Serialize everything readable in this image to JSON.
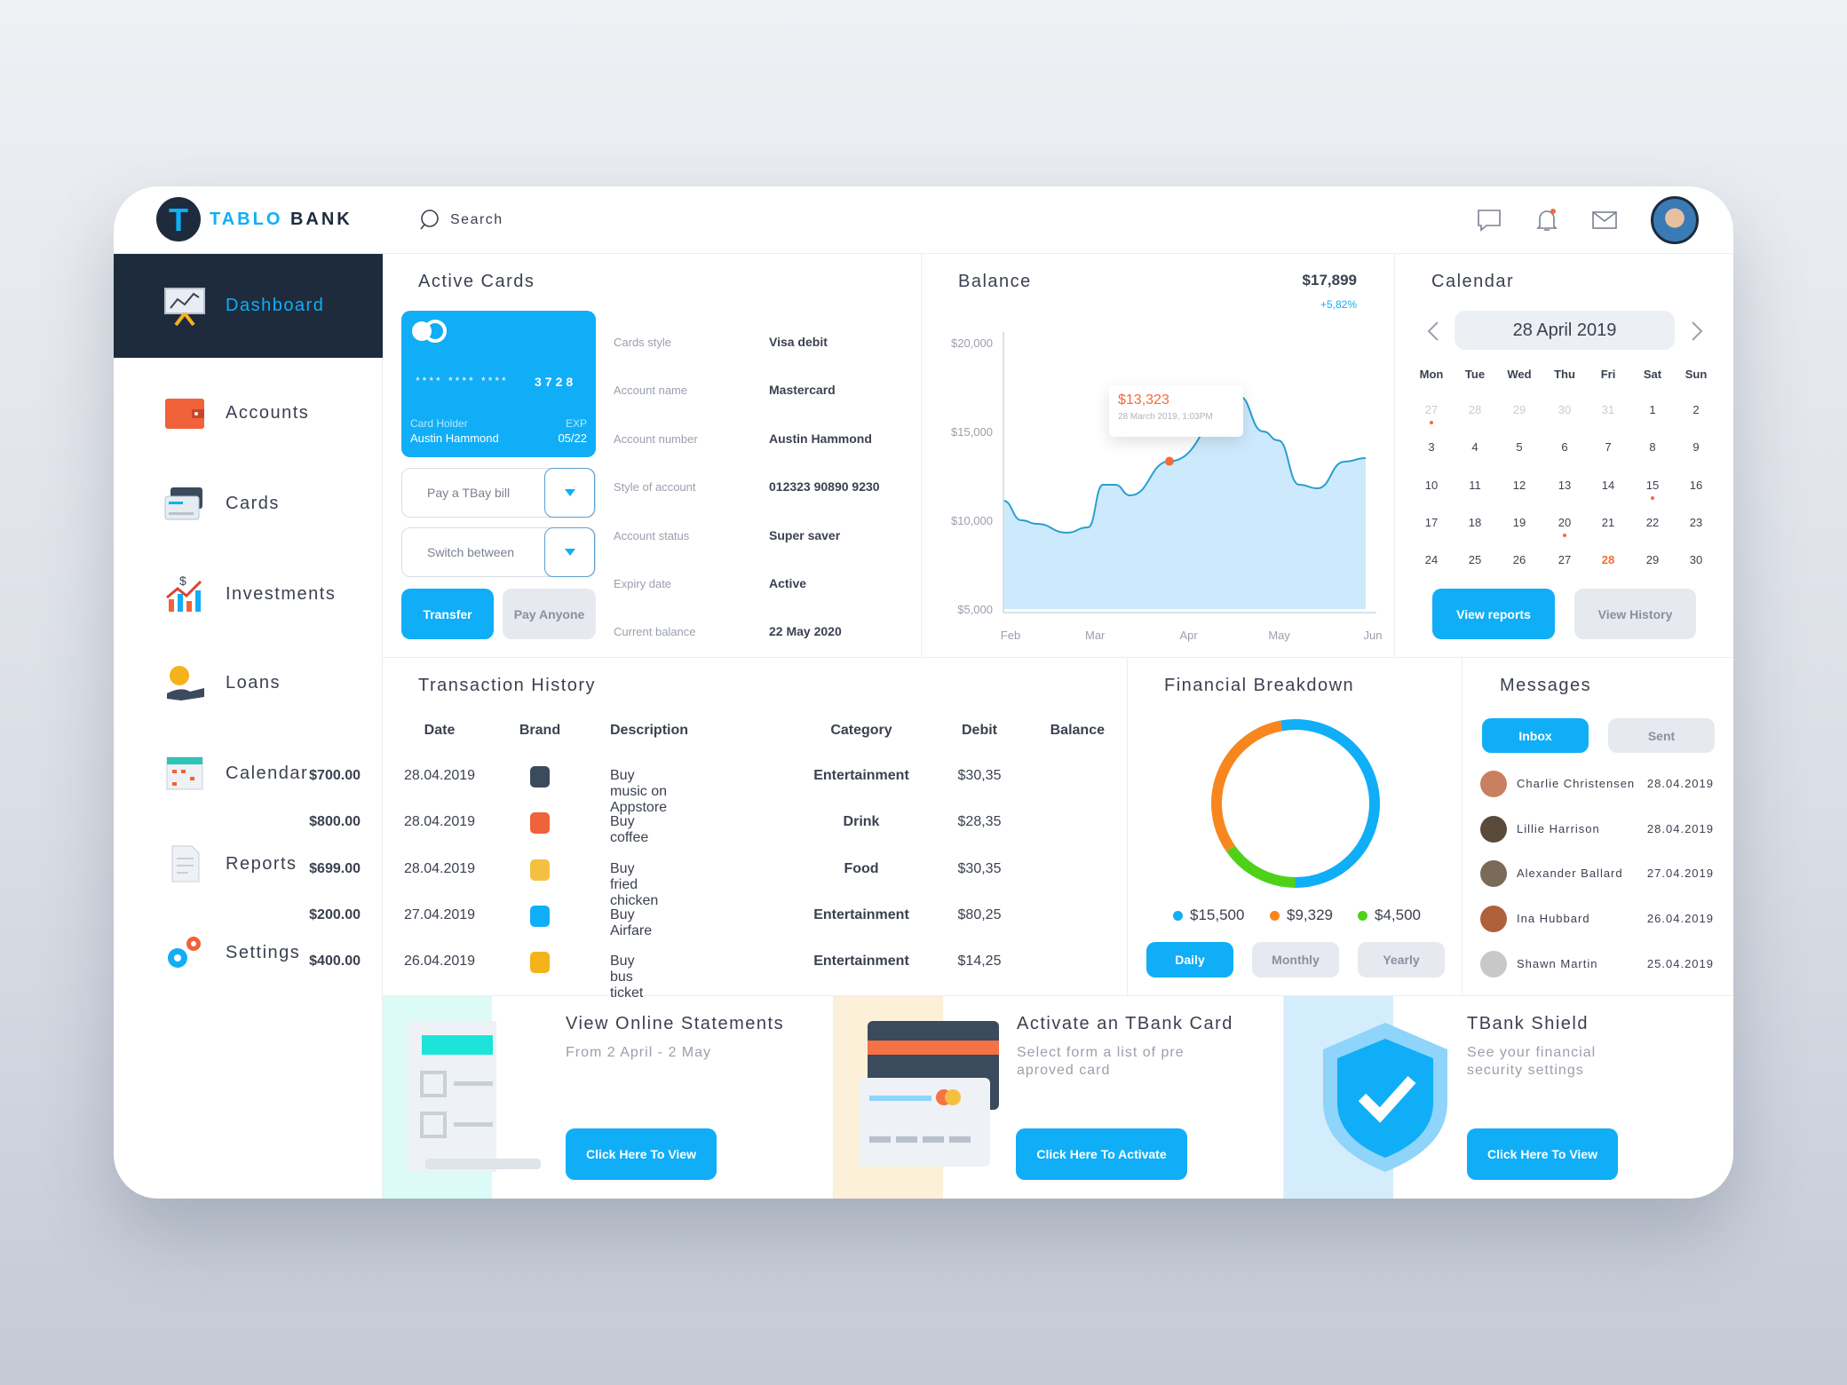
{
  "brand": {
    "name_part1": "TABLO",
    "name_part2": "BANK",
    "logo_letter": "T"
  },
  "header": {
    "search_placeholder": "Search",
    "icons": [
      "chat-icon",
      "bell-icon",
      "mail-icon"
    ]
  },
  "sidebar": {
    "items": [
      {
        "label": "Dashboard",
        "icon": "dashboard-icon",
        "active": true
      },
      {
        "label": "Accounts",
        "icon": "wallet-icon"
      },
      {
        "label": "Cards",
        "icon": "cards-icon"
      },
      {
        "label": "Investments",
        "icon": "investments-icon"
      },
      {
        "label": "Loans",
        "icon": "loans-icon"
      },
      {
        "label": "Calendar",
        "icon": "calendar-icon"
      },
      {
        "label": "Reports",
        "icon": "reports-icon"
      },
      {
        "label": "Settings",
        "icon": "settings-icon"
      }
    ]
  },
  "active_cards": {
    "title": "Active Cards",
    "card": {
      "number_mask": "****  ****  ****",
      "last4": "3728",
      "holder_label": "Card Holder",
      "holder": "Austin Hammond",
      "exp_label": "EXP",
      "exp": "05/22"
    },
    "dropdown1": "Pay a TBay bill",
    "dropdown2": "Switch between",
    "transfer": "Transfer",
    "pay_anyone": "Pay Anyone",
    "details": [
      {
        "label": "Cards style",
        "value": "Visa debit"
      },
      {
        "label": "Account name",
        "value": "Mastercard"
      },
      {
        "label": "Account number",
        "value": "Austin Hammond"
      },
      {
        "label": "Style of account",
        "value": "012323 90890 9230"
      },
      {
        "label": "Account status",
        "value": "Super saver"
      },
      {
        "label": "Expiry date",
        "value": "Active"
      },
      {
        "label": "Current balance",
        "value": "22 May 2020"
      }
    ]
  },
  "balance": {
    "title": "Balance",
    "total": "$17,899",
    "change": "+5,82%"
  },
  "chart_data": [
    {
      "type": "area",
      "title": "Balance",
      "ylim": [
        5000,
        20000
      ],
      "yticks": [
        "$20,000",
        "$15,000",
        "$10,000",
        "$5,000"
      ],
      "ytick_values": [
        20000,
        15000,
        10000,
        5000
      ],
      "xticks": [
        "Feb",
        "Mar",
        "Apr",
        "May",
        "Jun"
      ],
      "xtick_dates": [
        "2019-02-01",
        "2019-03-01",
        "2019-04-01",
        "2019-05-01",
        "2019-06-01"
      ],
      "grid": false,
      "color": "#2a9fd0",
      "fill": "#cdeafc",
      "points": [
        {
          "date": "2019-02-01",
          "value": 11100
        },
        {
          "date": "2019-02-07",
          "value": 10000
        },
        {
          "date": "2019-02-12",
          "value": 9800
        },
        {
          "date": "2019-02-22",
          "value": 9300
        },
        {
          "date": "2019-03-01",
          "value": 9600
        },
        {
          "date": "2019-03-06",
          "value": 12000
        },
        {
          "date": "2019-03-10",
          "value": 12000
        },
        {
          "date": "2019-03-15",
          "value": 11400
        },
        {
          "date": "2019-03-28",
          "value": 13323
        },
        {
          "date": "2019-04-20",
          "value": 17000
        },
        {
          "date": "2019-04-28",
          "value": 15000
        },
        {
          "date": "2019-05-03",
          "value": 14500
        },
        {
          "date": "2019-05-10",
          "value": 12000
        },
        {
          "date": "2019-05-16",
          "value": 11800
        },
        {
          "date": "2019-05-25",
          "value": 13300
        },
        {
          "date": "2019-06-01",
          "value": 13500
        }
      ],
      "tooltip": {
        "date": "2019-03-28",
        "value_label": "$13,323",
        "date_label": "28 March 2019, 1:03PM",
        "color": "#f26b3a"
      }
    },
    {
      "type": "pie",
      "title": "Financial Breakdown",
      "donut": true,
      "slices": [
        {
          "label": "$15,500",
          "value": 15500,
          "color": "#10aef7"
        },
        {
          "label": "$9,329",
          "value": 9329,
          "color": "#f7861e"
        },
        {
          "label": "$4,500",
          "value": 4500,
          "color": "#4fd11a"
        }
      ]
    }
  ],
  "calendar": {
    "title": "Calendar",
    "date": "28 April 2019",
    "weekdays": [
      "Mon",
      "Tue",
      "Wed",
      "Thu",
      "Fri",
      "Sat",
      "Sun"
    ],
    "days": [
      {
        "d": "27",
        "muted": true,
        "dot": true
      },
      {
        "d": "28",
        "muted": true
      },
      {
        "d": "29",
        "muted": true
      },
      {
        "d": "30",
        "muted": true
      },
      {
        "d": "31",
        "muted": true
      },
      {
        "d": "1"
      },
      {
        "d": "2"
      },
      {
        "d": "3"
      },
      {
        "d": "4"
      },
      {
        "d": "5"
      },
      {
        "d": "6"
      },
      {
        "d": "7"
      },
      {
        "d": "8"
      },
      {
        "d": "9"
      },
      {
        "d": "10"
      },
      {
        "d": "11"
      },
      {
        "d": "12"
      },
      {
        "d": "13"
      },
      {
        "d": "14"
      },
      {
        "d": "15",
        "dot": true
      },
      {
        "d": "16"
      },
      {
        "d": "17"
      },
      {
        "d": "18"
      },
      {
        "d": "19"
      },
      {
        "d": "20",
        "dot": true
      },
      {
        "d": "21"
      },
      {
        "d": "22"
      },
      {
        "d": "23"
      },
      {
        "d": "24"
      },
      {
        "d": "25"
      },
      {
        "d": "26"
      },
      {
        "d": "27"
      },
      {
        "d": "28",
        "today": true
      },
      {
        "d": "29"
      },
      {
        "d": "30"
      }
    ],
    "view_reports": "View reports",
    "view_history": "View History"
  },
  "transactions": {
    "title": "Transaction History",
    "columns": [
      "Date",
      "Brand",
      "Description",
      "Category",
      "Debit",
      "Balance"
    ],
    "rows": [
      {
        "date": "28.04.2019",
        "brand_icon": "phone-icon",
        "description": "Buy music on Appstore",
        "category": "Entertainment",
        "debit": "$30,35",
        "balance": "$700.00"
      },
      {
        "date": "28.04.2019",
        "brand_icon": "coffee-cup-icon",
        "description": "Buy coffee",
        "category": "Drink",
        "debit": "$28,35",
        "balance": "$800.00"
      },
      {
        "date": "28.04.2019",
        "brand_icon": "chicken-icon",
        "description": "Buy fried chicken",
        "category": "Food",
        "debit": "$30,35",
        "balance": "$699.00"
      },
      {
        "date": "27.04.2019",
        "brand_icon": "airplane-icon",
        "description": "Buy Airfare",
        "category": "Entertainment",
        "debit": "$80,25",
        "balance": "$200.00"
      },
      {
        "date": "26.04.2019",
        "brand_icon": "bus-icon",
        "description": "Buy bus ticket",
        "category": "Entertainment",
        "debit": "$14,25",
        "balance": "$400.00"
      }
    ]
  },
  "financial": {
    "title": "Financial Breakdown",
    "tabs": [
      "Daily",
      "Monthly",
      "Yearly"
    ],
    "active_tab": "Daily"
  },
  "messages": {
    "title": "Messages",
    "tabs": [
      "Inbox",
      "Sent"
    ],
    "active_tab": "Inbox",
    "items": [
      {
        "name": "Charlie Christensen",
        "date": "28.04.2019",
        "avatar_color": "#c98060"
      },
      {
        "name": "Lillie Harrison",
        "date": "28.04.2019",
        "avatar_color": "#5a4a3a"
      },
      {
        "name": "Alexander Ballard",
        "date": "27.04.2019",
        "avatar_color": "#7a6a5a"
      },
      {
        "name": "Ina Hubbard",
        "date": "26.04.2019",
        "avatar_color": "#b0603a"
      },
      {
        "name": "Shawn Martin",
        "date": "25.04.2019",
        "avatar_color": "#c8c8c8"
      }
    ]
  },
  "promos": [
    {
      "title": "View Online Statements",
      "subtitle": "From 2 April - 2 May",
      "button": "Click Here To View",
      "stripe": "#dcfaf6"
    },
    {
      "title": "Activate an TBank Card",
      "subtitle": "Select form a list of pre aproved card",
      "button": "Click Here To Activate",
      "stripe": "#fdf0d9"
    },
    {
      "title": "TBank Shield",
      "subtitle": "See your financial security settings",
      "button": "Click Here To View",
      "stripe": "#d3edfd"
    }
  ],
  "colors": {
    "accent": "#10aef7",
    "sidebar_active": "#1d2b3d",
    "alert": "#f26b3a"
  }
}
